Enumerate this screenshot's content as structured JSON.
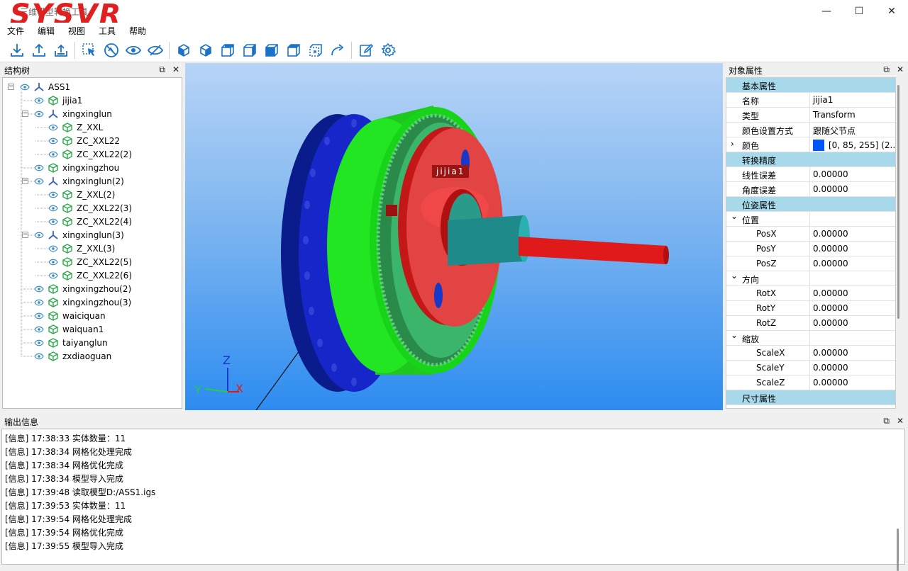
{
  "window": {
    "logo_text": "SYSVR",
    "title": "三维模型转换工具",
    "minimize": "—",
    "maximize": "☐",
    "close": "✕"
  },
  "menu": [
    "文件",
    "编辑",
    "视图",
    "工具",
    "帮助"
  ],
  "toolbar_icons": [
    "import-icon",
    "export-icon",
    "upload-icon",
    "select-icon",
    "hide-icon",
    "show-icon",
    "show-all-icon",
    "view-iso-icon",
    "view-front-icon",
    "view-back-icon",
    "view-left-icon",
    "view-right-icon",
    "view-top-icon",
    "view-bottom-icon",
    "rotate-icon",
    "edit-icon",
    "settings-icon"
  ],
  "structure_tree": {
    "title": "结构树",
    "float_icon": "⧉",
    "close_icon": "✕",
    "nodes": [
      {
        "label": "ASS1",
        "type": "assembly",
        "level": 0,
        "expandable": true
      },
      {
        "label": "jijia1",
        "type": "part",
        "level": 1
      },
      {
        "label": "xingxinglun",
        "type": "assembly",
        "level": 1,
        "expandable": true
      },
      {
        "label": "Z_XXL",
        "type": "part",
        "level": 2
      },
      {
        "label": "ZC_XXL22",
        "type": "part",
        "level": 2
      },
      {
        "label": "ZC_XXL22(2)",
        "type": "part",
        "level": 2
      },
      {
        "label": "xingxingzhou",
        "type": "part",
        "level": 1
      },
      {
        "label": "xingxinglun(2)",
        "type": "assembly",
        "level": 1,
        "expandable": true
      },
      {
        "label": "Z_XXL(2)",
        "type": "part",
        "level": 2
      },
      {
        "label": "ZC_XXL22(3)",
        "type": "part",
        "level": 2
      },
      {
        "label": "ZC_XXL22(4)",
        "type": "part",
        "level": 2
      },
      {
        "label": "xingxinglun(3)",
        "type": "assembly",
        "level": 1,
        "expandable": true
      },
      {
        "label": "Z_XXL(3)",
        "type": "part",
        "level": 2
      },
      {
        "label": "ZC_XXL22(5)",
        "type": "part",
        "level": 2
      },
      {
        "label": "ZC_XXL22(6)",
        "type": "part",
        "level": 2
      },
      {
        "label": "xingxingzhou(2)",
        "type": "part",
        "level": 1
      },
      {
        "label": "xingxingzhou(3)",
        "type": "part",
        "level": 1
      },
      {
        "label": "waiciquan",
        "type": "part",
        "level": 1
      },
      {
        "label": "waiquan1",
        "type": "part",
        "level": 1
      },
      {
        "label": "taiyanglun",
        "type": "part",
        "level": 1
      },
      {
        "label": "zxdiaoguan",
        "type": "part",
        "level": 1
      }
    ]
  },
  "viewport": {
    "label": "jijia1",
    "axis_x": "X",
    "axis_y": "Y",
    "axis_z": "Z"
  },
  "properties": {
    "title": "对象属性",
    "float_icon": "⧉",
    "close_icon": "✕",
    "rows": [
      {
        "kind": "section",
        "key": "基本属性"
      },
      {
        "kind": "row",
        "key": "名称",
        "value": "jijia1"
      },
      {
        "kind": "row",
        "key": "类型",
        "value": "Transform"
      },
      {
        "kind": "row",
        "key": "颜色设置方式",
        "value": "跟随父节点"
      },
      {
        "kind": "color",
        "key": "颜色",
        "value": "[0, 85, 255] (2...",
        "swatch": "#0055ff"
      },
      {
        "kind": "section",
        "key": "转换精度"
      },
      {
        "kind": "row",
        "key": "线性误差",
        "value": "0.00000"
      },
      {
        "kind": "row",
        "key": "角度误差",
        "value": "0.00000"
      },
      {
        "kind": "section",
        "key": "位姿属性"
      },
      {
        "kind": "group",
        "key": "位置"
      },
      {
        "kind": "sub",
        "key": "PosX",
        "value": "0.00000"
      },
      {
        "kind": "sub",
        "key": "PosY",
        "value": "0.00000"
      },
      {
        "kind": "sub",
        "key": "PosZ",
        "value": "0.00000"
      },
      {
        "kind": "group",
        "key": "方向"
      },
      {
        "kind": "sub",
        "key": "RotX",
        "value": "0.00000"
      },
      {
        "kind": "sub",
        "key": "RotY",
        "value": "0.00000"
      },
      {
        "kind": "sub",
        "key": "RotZ",
        "value": "0.00000"
      },
      {
        "kind": "group",
        "key": "缩放"
      },
      {
        "kind": "sub",
        "key": "ScaleX",
        "value": "0.00000"
      },
      {
        "kind": "sub",
        "key": "ScaleY",
        "value": "0.00000"
      },
      {
        "kind": "sub",
        "key": "ScaleZ",
        "value": "0.00000"
      },
      {
        "kind": "section",
        "key": "尺寸属性"
      }
    ]
  },
  "output": {
    "title": "输出信息",
    "float_icon": "⧉",
    "close_icon": "✕",
    "lines": [
      "[信息] 17:38:33 实体数量：11",
      "[信息] 17:38:34 网格化处理完成",
      "[信息] 17:38:34 网格优化完成",
      "[信息] 17:38:34 模型导入完成",
      "[信息] 17:39:48 读取模型D:/ASS1.igs",
      "[信息] 17:39:53 实体数量：11",
      "[信息] 17:39:54 网格化处理完成",
      "[信息] 17:39:54 网格优化完成",
      "[信息] 17:39:55 模型导入完成"
    ]
  },
  "colors": {
    "accent": "#1a73c8",
    "section_bg": "#a8d9ea",
    "part_icon": "#2aa84a",
    "assembly_icon": "#3a62b8"
  }
}
